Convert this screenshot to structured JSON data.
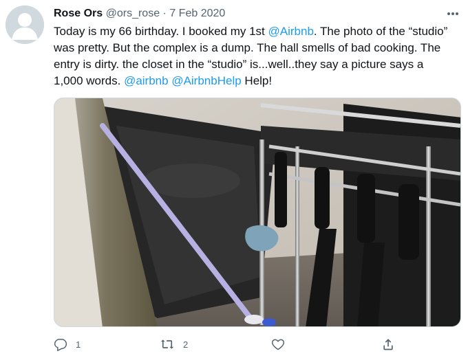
{
  "tweet": {
    "name": "Rose Ors",
    "handle": "@ors_rose",
    "separator": "·",
    "date": "7 Feb 2020",
    "text_parts": {
      "p1": "Today is my 66 birthday. I booked my 1st ",
      "m1": "@Airbnb",
      "p2": ". The photo of the “studio” was pretty. But the complex is a dump. The hall smells of bad cooking. The entry is dirty. the closet in the “studio” is...well..they say a picture says a 1,000 words. ",
      "m2": "@airbnb",
      "p3": " ",
      "m3": "@AirbnbHelp",
      "p4": " Help!"
    },
    "media_icon": "photo-closet-luggage-rack"
  },
  "actions": {
    "reply_count": "1",
    "retweet_count": "2"
  },
  "icons": {
    "more": "more-horizontal-icon",
    "reply": "reply-icon",
    "retweet": "retweet-icon",
    "like": "heart-icon",
    "share": "share-icon"
  },
  "colors": {
    "accent": "#1d9bf0",
    "secondary_text": "#536471",
    "avatar_bg": "#cfd9de"
  }
}
